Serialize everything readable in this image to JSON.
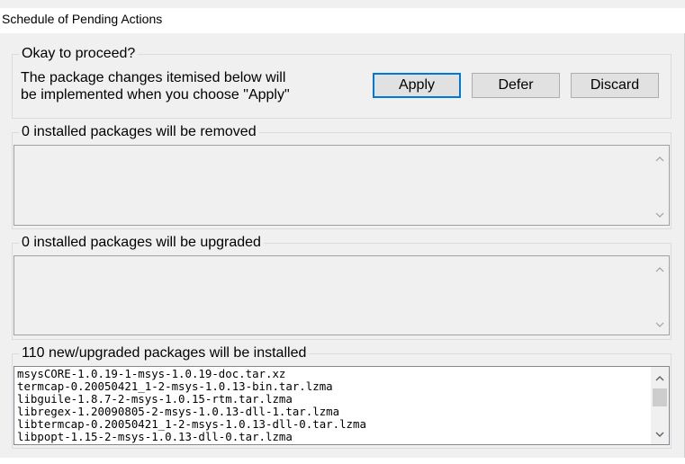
{
  "window": {
    "title": "Schedule of Pending Actions"
  },
  "proceed": {
    "legend": "Okay to proceed?",
    "message_line1": "The package changes itemised below will",
    "message_line2": "be implemented when you choose \"Apply\"",
    "apply_label": "Apply",
    "defer_label": "Defer",
    "discard_label": "Discard"
  },
  "removed": {
    "legend": "0 installed packages will be removed",
    "items": []
  },
  "upgraded": {
    "legend": "0 installed packages will be upgraded",
    "items": []
  },
  "installed": {
    "legend": "110 new/upgraded packages will be installed",
    "items": [
      "msysCORE-1.0.19-1-msys-1.0.19-doc.tar.xz",
      "termcap-0.20050421_1-2-msys-1.0.13-bin.tar.lzma",
      "libguile-1.8.7-2-msys-1.0.15-rtm.tar.lzma",
      "libregex-1.20090805-2-msys-1.0.13-dll-1.tar.lzma",
      "libtermcap-0.20050421_1-2-msys-1.0.13-dll-0.tar.lzma",
      "libpopt-1.15-2-msys-1.0.13-dll-0.tar.lzma"
    ]
  },
  "icons": {
    "scroll_up": "chevron-up-icon",
    "scroll_down": "chevron-down-icon"
  },
  "colors": {
    "dialog_bg": "#f0f0f0",
    "default_button_border": "#0078d7",
    "button_face": "#e1e1e1"
  }
}
